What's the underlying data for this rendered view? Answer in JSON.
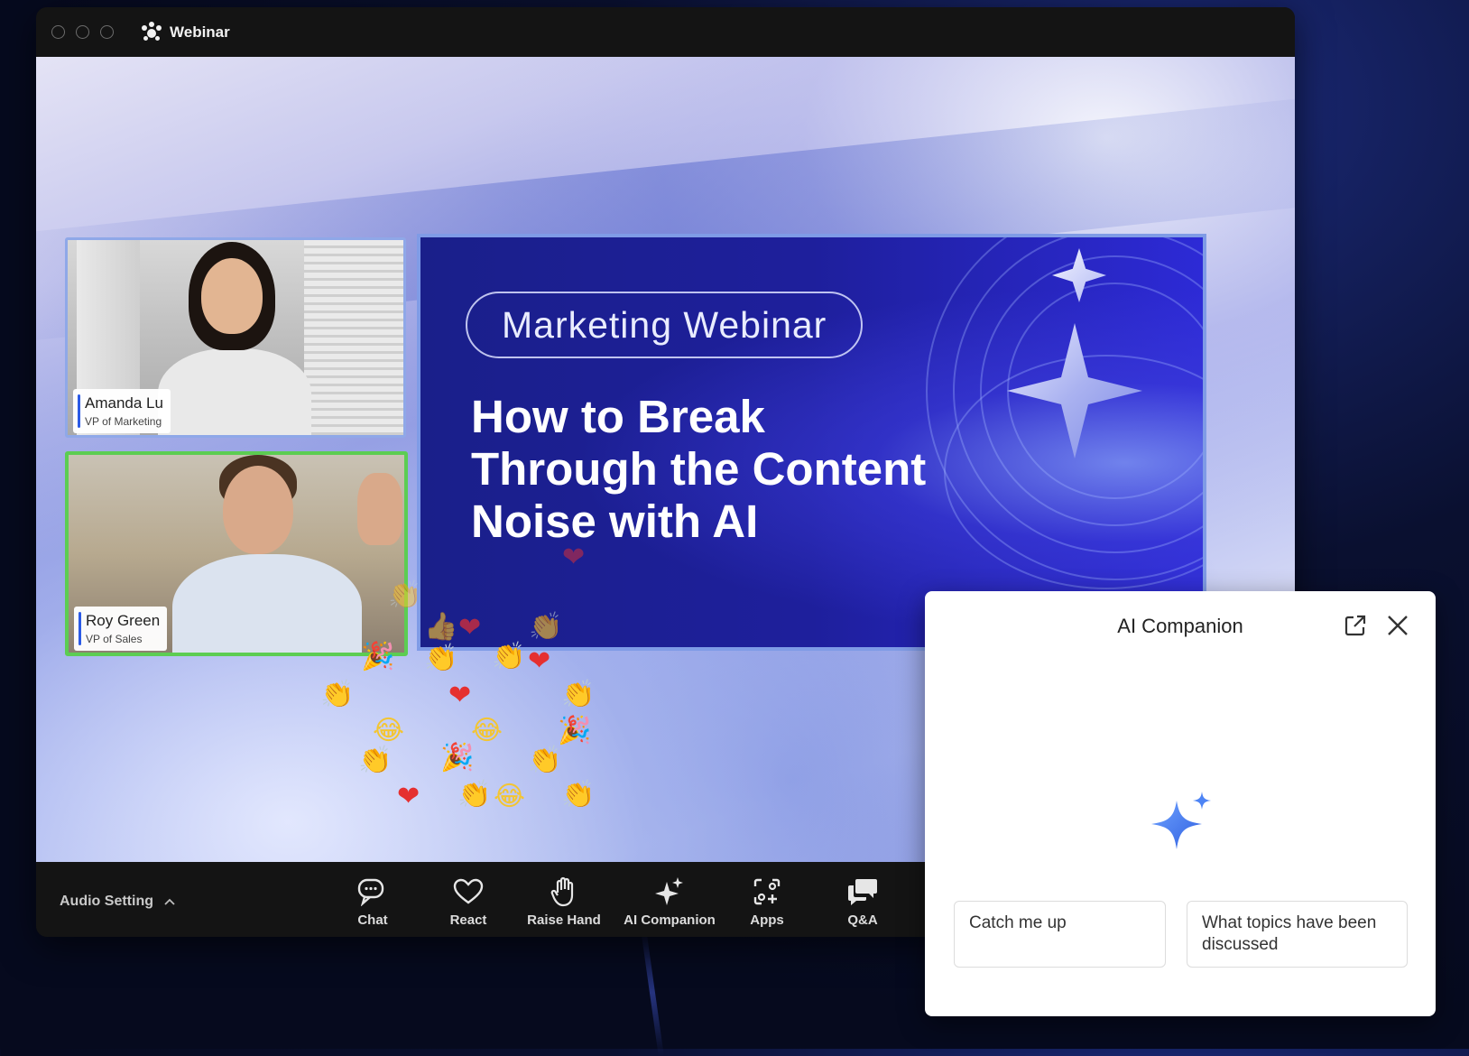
{
  "window": {
    "app_title": "Webinar"
  },
  "participants": [
    {
      "name": "Amanda Lu",
      "role": "VP of Marketing"
    },
    {
      "name": "Roy Green",
      "role": "VP of Sales"
    }
  ],
  "slide": {
    "tag": "Marketing Webinar",
    "headline_lines": [
      "How to Break",
      "Through the Content",
      "Noise with AI"
    ]
  },
  "toolbar": {
    "audio_setting": "Audio Setting",
    "buttons": [
      {
        "label": "Chat",
        "icon": "chat-icon"
      },
      {
        "label": "React",
        "icon": "heart-icon"
      },
      {
        "label": "Raise Hand",
        "icon": "hand-icon"
      },
      {
        "label": "AI Companion",
        "icon": "sparkle-icon"
      },
      {
        "label": "Apps",
        "icon": "apps-icon"
      },
      {
        "label": "Q&A",
        "icon": "qa-icon"
      }
    ]
  },
  "ai_companion": {
    "title": "AI Companion",
    "suggestions": [
      "Catch me up",
      "What topics have been discussed"
    ]
  },
  "reactions": {
    "heart": "❤",
    "clap": "👏",
    "laugh": "😂",
    "party": "🎉",
    "thumb": "👍"
  },
  "colors": {
    "speaker_border": "#5ccd52",
    "accent_blue": "#2b5ae6",
    "slide_bg": "#1e1f9c"
  }
}
